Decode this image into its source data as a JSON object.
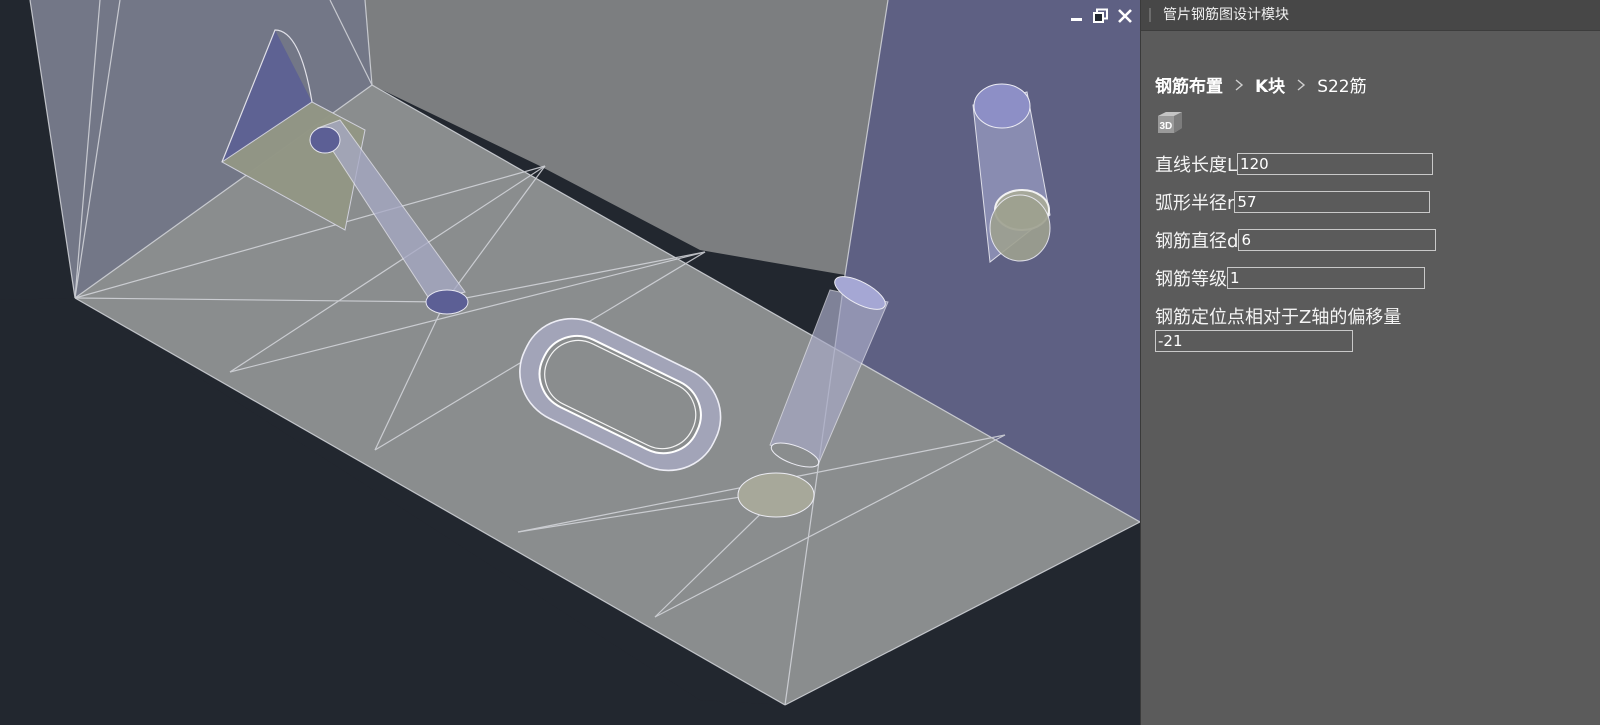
{
  "viewport": {
    "controls": {
      "minimize": "minimize-icon",
      "restore": "restore-icon",
      "close": "close-icon"
    }
  },
  "panel": {
    "title": "管片钢筋图设计模块",
    "breadcrumb": [
      {
        "label": "钢筋布置"
      },
      {
        "label": "K块"
      },
      {
        "label": "S22筋"
      }
    ],
    "view3d_icon": "3d-icon",
    "fields": {
      "straight_length": {
        "label": "直线长度L",
        "value": "120"
      },
      "arc_radius": {
        "label": "弧形半径r",
        "value": "57"
      },
      "rebar_diameter": {
        "label": "钢筋直径d",
        "value": "6"
      },
      "rebar_grade": {
        "label": "钢筋等级",
        "value": "1"
      },
      "z_offset": {
        "label": "钢筋定位点相对于Z轴的偏移量",
        "value": "-21"
      }
    }
  },
  "colors": {
    "background": "#22272f",
    "panel": "#5b5b5b",
    "model_gray": "#8a8d8f",
    "model_purple": "#5d5f82"
  }
}
